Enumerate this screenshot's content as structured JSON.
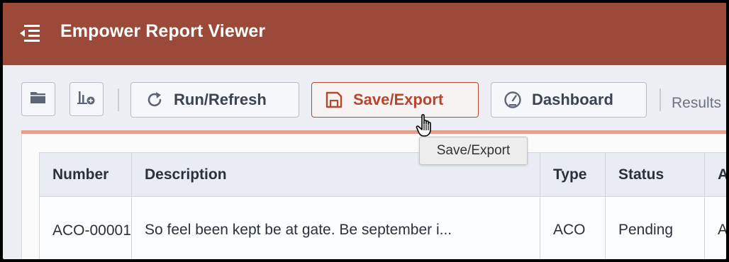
{
  "app": {
    "title": "Empower Report Viewer",
    "menu_icon": "menu-collapse-icon"
  },
  "toolbar": {
    "open_icon": "folder-icon",
    "add_chart_icon": "chart-add-icon",
    "run_label": "Run/Refresh",
    "save_label": "Save/Export",
    "dashboard_label": "Dashboard",
    "results_label": "Results"
  },
  "tooltip": {
    "text": "Save/Export"
  },
  "table": {
    "columns": [
      "Number",
      "Description",
      "Type",
      "Status",
      "A"
    ],
    "rows": [
      {
        "number": "ACO-00001",
        "description": "So feel been kept be at gate. Be september i...",
        "type": "ACO",
        "status": "Pending",
        "extra": "A"
      }
    ]
  },
  "colors": {
    "header": "#9b4a39",
    "accent": "#b5472e",
    "accent_line": "#e2a08f",
    "background": "#eceef3"
  }
}
